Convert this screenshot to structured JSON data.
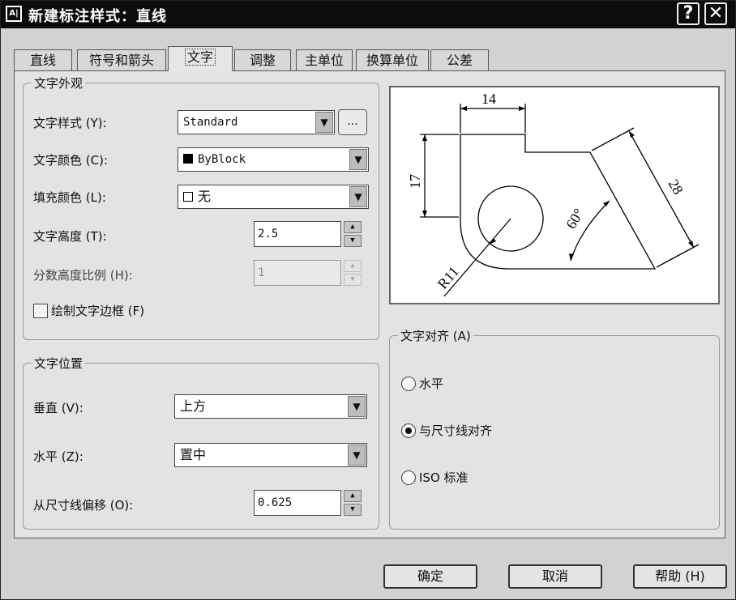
{
  "window": {
    "title": "新建标注样式：直线",
    "app_icon": "A|",
    "help_glyph": "?",
    "close_glyph": "✕"
  },
  "tabs": [
    {
      "label": "直线"
    },
    {
      "label": "符号和箭头"
    },
    {
      "label": "文字",
      "active": true
    },
    {
      "label": "调整"
    },
    {
      "label": "主单位"
    },
    {
      "label": "换算单位"
    },
    {
      "label": "公差"
    }
  ],
  "appearance": {
    "title": "文字外观",
    "text_style_label": "文字样式 (Y):",
    "text_style_value": "Standard",
    "ellipsis": "...",
    "text_color_label": "文字颜色 (C):",
    "text_color_value": "ByBlock",
    "fill_color_label": "填充颜色 (L):",
    "fill_color_value": "无",
    "text_height_label": "文字高度 (T):",
    "text_height_value": "2.5",
    "fraction_scale_label": "分数高度比例 (H):",
    "fraction_scale_value": "1",
    "draw_frame_label": "绘制文字边框 (F)"
  },
  "placement": {
    "title": "文字位置",
    "vertical_label": "垂直 (V):",
    "vertical_value": "上方",
    "horizontal_label": "水平 (Z):",
    "horizontal_value": "置中",
    "offset_label": "从尺寸线偏移 (O):",
    "offset_value": "0.625"
  },
  "alignment": {
    "title": "文字对齐 (A)",
    "options": [
      {
        "label": "水平",
        "checked": false
      },
      {
        "label": "与尺寸线对齐",
        "checked": true
      },
      {
        "label": "ISO 标准",
        "checked": false
      }
    ]
  },
  "preview": {
    "dim_top": "14",
    "dim_left": "17",
    "dim_slant": "28",
    "dim_angle": "60°",
    "dim_radius": "R11"
  },
  "buttons": {
    "ok": "确定",
    "cancel": "取消",
    "help": "帮助 (H)"
  },
  "icons": {
    "dropdown": "chevron-down-icon",
    "spin": "spin-arrows-icon"
  }
}
